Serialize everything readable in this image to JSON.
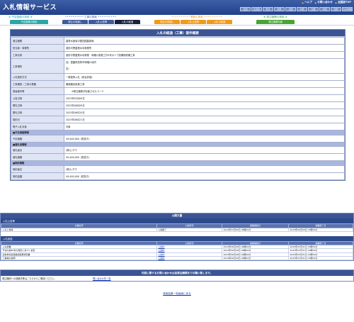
{
  "header": {
    "title": "入札情報サービス",
    "links": [
      "ヘルプ",
      "お問い合わせ",
      "全国版TOP"
    ],
    "regions": [
      "全国",
      "北海道",
      "東北",
      "関東",
      "北陸",
      "中部",
      "近畿",
      "中国",
      "四国",
      "九州沖縄"
    ]
  },
  "menu": {
    "groups": [
      {
        "label": "予定価格の検索",
        "color": "#2ba6a6",
        "tabs": [
          {
            "label": "予定価格の検索"
          }
        ]
      },
      {
        "label": "工事の検索",
        "color": "#3e5b9d",
        "tabs": [
          {
            "label": "発注の見通し"
          },
          {
            "label": "入札公告等"
          },
          {
            "label": "入札の経過",
            "active": true
          }
        ]
      },
      {
        "label": "業務の検索",
        "color": "#f09a1a",
        "tabs": [
          {
            "label": "発注の見通し"
          },
          {
            "label": "入札公告等"
          },
          {
            "label": "入札の経過"
          }
        ]
      },
      {
        "label": "発注機関の検索",
        "color": "#49a436",
        "tabs": [
          {
            "label": "発注機関情報"
          }
        ]
      }
    ]
  },
  "detail": {
    "title": "入札の経過（工事）案件概要",
    "rows": [
      {
        "label": "発注機関",
        "value": "農林水産省中国四国農政局"
      },
      {
        "label": "担当部・事務所",
        "value": "道前平野農業水利事業所"
      },
      {
        "label": "工事名称",
        "value": "道前平野農業水利事業　明増川頭首工外4号ポンプ設備他修補工事"
      },
      {
        "label": "工事場所",
        "lines": [
          "自）愛媛県西条市明増川地内",
          "至）"
        ]
      },
      {
        "label": "入札契約方式",
        "value": "一般競争入札（総合評価）"
      },
      {
        "label": "工事種別／工事の業種",
        "value": "機械器具設置工事"
      },
      {
        "label": "調達番号等",
        "value": "※発注機関が採番されたコード",
        "indent": true
      },
      {
        "label": "公告日時",
        "value": "2023年03月09日"
      },
      {
        "label": "開札日時",
        "value": "2023年06月09日"
      },
      {
        "label": "開札日時",
        "value": "2023年06月20日"
      },
      {
        "label": "契約日",
        "value": "2023年06月21日"
      },
      {
        "label": "電子入札対象",
        "value": "対象"
      }
    ],
    "sections": [
      {
        "title": "■予定価格情報",
        "rows": [
          {
            "label": "予定価格",
            "value": "49,000,000（税抜き）"
          }
        ]
      },
      {
        "title": "■落札者情報",
        "rows": [
          {
            "label": "落札者名",
            "value": "(株)ヒダマ"
          },
          {
            "label": "落札価格",
            "value": "49,400,000（税抜き）"
          }
        ]
      },
      {
        "title": "■契約情報",
        "rows": [
          {
            "label": "契約者名",
            "value": "(株)ヒダマ"
          },
          {
            "label": "契約金額",
            "value": "49,400,000（税抜き）"
          }
        ]
      }
    ]
  },
  "documents": {
    "title": "公開文書",
    "groups": [
      {
        "heading": "入札公告等",
        "columns": [
          "文書名称",
          "公開状況",
          "掲載開始日",
          "掲載終了日"
        ],
        "rows": [
          {
            "name": "入札公告等",
            "status": "公開終了",
            "start": "2023年03月09日 08時00分",
            "end": "2023年06月09日 23時59分",
            "link": false
          }
        ]
      },
      {
        "heading": "入札経過",
        "columns": [
          "文書名称",
          "公開状況",
          "掲載開始日",
          "掲載終了日"
        ],
        "rows": [
          {
            "name": "入札調書",
            "status": "公開中",
            "start": "2023年06月28日 09時00分",
            "end": "2025年03月31日 23時59分",
            "link": true
          },
          {
            "name": "予決令第85条の規定に基づく審査",
            "status": "公開中",
            "start": "2023年06月28日 09時00分",
            "end": "2025年03月31日 23時59分",
            "link": true
          },
          {
            "name": "競争参加資格確認結果通知書",
            "status": "公開中",
            "start": "2023年06月28日 09時00分",
            "end": "2025年03月31日 23時59分",
            "link": true
          },
          {
            "name": "工事等の説明",
            "status": "公開中",
            "start": "2023年06月28日 09時00分",
            "end": "2025年03月31日 23時59分",
            "link": true
          }
        ]
      }
    ]
  },
  "inquiry": {
    "title": "内容に関するお問い合わせは各発注機関までお願い致します。",
    "label": "発注機関への連絡先等はこちらからご確認ください。",
    "link": "問い合わせ先一覧"
  },
  "back_link": "検索結果一覧画面に戻る"
}
